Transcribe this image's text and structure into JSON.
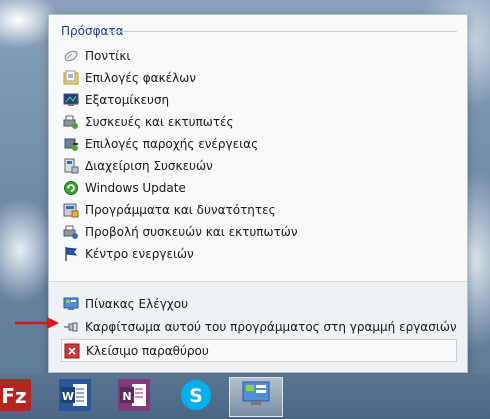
{
  "jumplist": {
    "section_title": "Πρόσφατα",
    "recent": [
      {
        "label": "Ποντίκι",
        "icon": "mouse-icon"
      },
      {
        "label": "Επιλογές φακέλων",
        "icon": "folder-options-icon"
      },
      {
        "label": "Εξατομίκευση",
        "icon": "personalization-icon"
      },
      {
        "label": "Συσκευές και εκτυπωτές",
        "icon": "devices-printers-icon"
      },
      {
        "label": "Επιλογές παροχής ενέργειας",
        "icon": "power-options-icon"
      },
      {
        "label": "Διαχείριση Συσκευών",
        "icon": "device-manager-icon"
      },
      {
        "label": "Windows Update",
        "icon": "windows-update-icon"
      },
      {
        "label": "Προγράμματα και δυνατότητες",
        "icon": "programs-features-icon"
      },
      {
        "label": "Προβολή συσκευών και εκτυπωτών",
        "icon": "view-devices-printers-icon"
      },
      {
        "label": "Κέντρο ενεργειών",
        "icon": "action-center-flag-icon"
      }
    ],
    "tasks": [
      {
        "label": "Πίνακας Ελέγχου",
        "icon": "control-panel-icon"
      },
      {
        "label": "Καρφίτσωμα αυτού του προγράμματος στη γραμμή εργασιών",
        "icon": "pin-icon"
      },
      {
        "label": "Κλείσιμο παραθύρου",
        "icon": "close-window-icon"
      }
    ]
  },
  "taskbar": {
    "apps": [
      {
        "name": "FileZilla",
        "icon": "filezilla-icon"
      },
      {
        "name": "Word",
        "icon": "word-icon"
      },
      {
        "name": "OneNote",
        "icon": "onenote-icon"
      },
      {
        "name": "Skype",
        "icon": "skype-icon"
      },
      {
        "name": "Control Panel",
        "icon": "control-panel-taskbar-icon",
        "active": true
      }
    ]
  },
  "colors": {
    "section_title": "#1e3f8f",
    "annotation_arrow": "#e0151b"
  }
}
